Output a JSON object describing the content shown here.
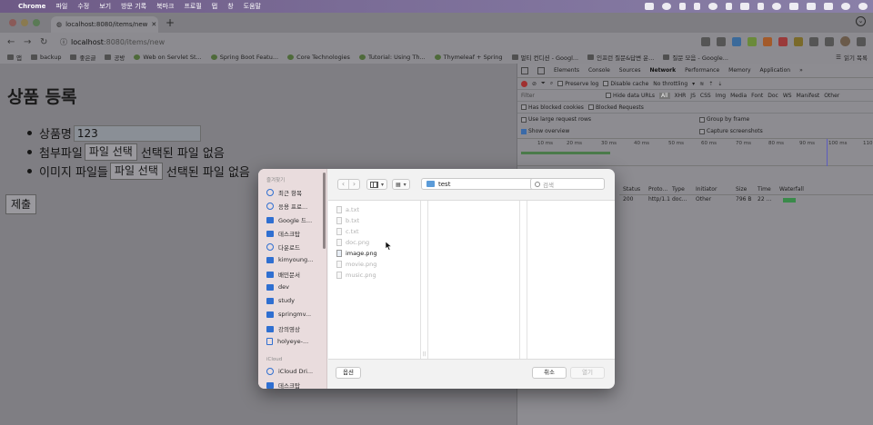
{
  "menubar": {
    "app": "Chrome",
    "items": [
      "파일",
      "수정",
      "보기",
      "방문 기록",
      "북마크",
      "프로필",
      "탭",
      "창",
      "도움말"
    ]
  },
  "browser": {
    "tab_title": "localhost:8080/items/new",
    "url_host": "localhost",
    "url_path": ":8080/items/new",
    "bookmarks": [
      "앱",
      "backup",
      "좋은글",
      "공방",
      "Web on Servlet St...",
      "Spring Boot Featu...",
      "Core Technologies",
      "Tutorial: Using Th...",
      "Thymeleaf + Spring",
      "멀티 컨디션 - Googl...",
      "인프런 질문&답변 운...",
      "질문 모음 - Google..."
    ],
    "reading_list": "읽기 목록"
  },
  "page": {
    "title": "상품 등록",
    "item_name_label": "상품명",
    "item_name_value": "123",
    "attach_label": "첨부파일",
    "attach_button": "파일 선택",
    "attach_status": "선택된 파일 없음",
    "images_label": "이미지 파일들",
    "images_button": "파일 선택",
    "images_status": "선택된 파일 없음",
    "submit": "제출"
  },
  "devtools": {
    "tabs": [
      "Elements",
      "Console",
      "Sources",
      "Network",
      "Performance",
      "Memory",
      "Application"
    ],
    "more": "»",
    "preserve_log": "Preserve log",
    "disable_cache": "Disable cache",
    "throttling": "No throttling",
    "filter_placeholder": "Filter",
    "hide_data_urls": "Hide data URLs",
    "filter_types": [
      "All",
      "XHR",
      "JS",
      "CSS",
      "Img",
      "Media",
      "Font",
      "Doc",
      "WS",
      "Manifest",
      "Other"
    ],
    "blocked_cookies": "Has blocked cookies",
    "blocked_requests": "Blocked Requests",
    "large_rows": "Use large request rows",
    "group_by_frame": "Group by frame",
    "show_overview": "Show overview",
    "capture_screenshots": "Capture screenshots",
    "ticks": [
      "10 ms",
      "20 ms",
      "30 ms",
      "40 ms",
      "50 ms",
      "60 ms",
      "70 ms",
      "80 ms",
      "90 ms",
      "100 ms",
      "110"
    ],
    "columns": [
      "Status",
      "Proto...",
      "Type",
      "Initiator",
      "Size",
      "Time",
      "Waterfall"
    ],
    "row": [
      "200",
      "http/1.1",
      "doc...",
      "Other",
      "796 B",
      "22 ..."
    ]
  },
  "dialog": {
    "sidebar_section_favorites": "즐겨찾기",
    "sidebar_favorites": [
      "최근 항목",
      "응용 프로...",
      "Google 드...",
      "데스크탑",
      "다운로드",
      "kimyoung...",
      "배민문서",
      "dev",
      "study",
      "springmv...",
      "강의영상",
      "holyeye-..."
    ],
    "sidebar_section_icloud": "iCloud",
    "sidebar_icloud": [
      "iCloud Dri...",
      "데스크탑"
    ],
    "location": "test",
    "search_placeholder": "검색",
    "files": [
      {
        "name": "a.txt",
        "enabled": false
      },
      {
        "name": "b.txt",
        "enabled": false
      },
      {
        "name": "c.txt",
        "enabled": false
      },
      {
        "name": "doc.png",
        "enabled": false
      },
      {
        "name": "image.png",
        "enabled": true
      },
      {
        "name": "movie.png",
        "enabled": false
      },
      {
        "name": "music.png",
        "enabled": false
      }
    ],
    "options_button": "옵션",
    "cancel_button": "취소",
    "open_button": "열기"
  }
}
